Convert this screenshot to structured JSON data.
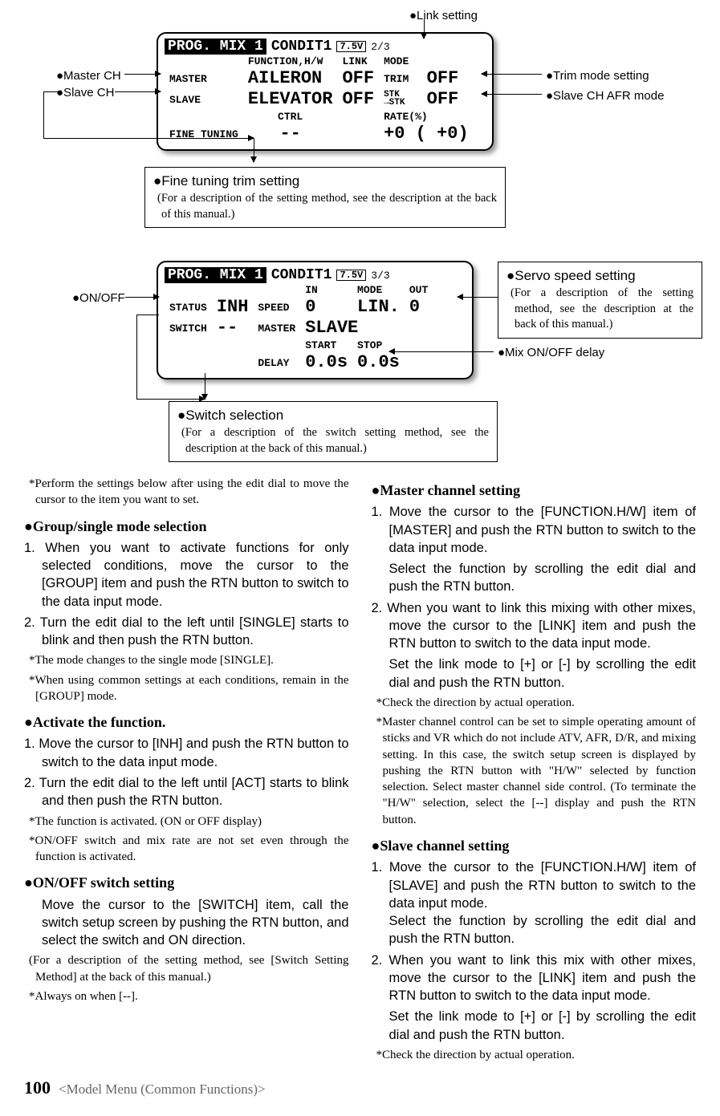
{
  "diagram": {
    "top_label_link": "●Link setting",
    "left_label_master": "●Master CH",
    "left_label_slave": "●Slave CH",
    "right_label_trim": "●Trim mode setting",
    "right_label_afr": "●Slave CH AFR mode",
    "left_label_onoff": "●ON/OFF",
    "right_label_mixdelay": "●Mix ON/OFF delay",
    "lcd1": {
      "title": "PROG. MIX 1",
      "condit": "CONDIT1",
      "batt": "7.5V",
      "page": "2/3",
      "func_hw": "FUNCTION,H/W",
      "link_hdr": "LINK",
      "mode_hdr": "MODE",
      "master_lbl": "MASTER",
      "master_val": "AILERON",
      "master_link": "OFF",
      "master_mode_lbl": "TRIM",
      "master_mode_val": "OFF",
      "slave_lbl": "SLAVE",
      "slave_val": "ELEVATOR",
      "slave_link": "OFF",
      "slave_mode_lbl": "STK\n→STK",
      "slave_mode_val": "OFF",
      "ctrl_hdr": "CTRL",
      "rate_hdr": "RATE(%)",
      "ft_lbl": "FINE TUNING",
      "ft_val": "--",
      "rate_val": "+0 (  +0)"
    },
    "callout_finetune": {
      "title": "●Fine tuning trim setting",
      "note": "(For a description of the setting method, see the description at the back of this manual.)"
    },
    "lcd2": {
      "title": "PROG. MIX 1",
      "condit": "CONDIT1",
      "batt": "7.5V",
      "page": "3/3",
      "in_hdr": "IN",
      "mode_hdr": "MODE",
      "out_hdr": "OUT",
      "status_lbl": "STATUS",
      "status_val": "INH",
      "speed_lbl": "SPEED",
      "speed_in": "0",
      "speed_mode": "LIN.",
      "speed_out": "0",
      "switch_lbl": "SWITCH",
      "switch_val": "--",
      "master_lbl": "MASTER",
      "master_val": "SLAVE",
      "start_hdr": "START",
      "stop_hdr": "STOP",
      "delay_lbl": "DELAY",
      "delay_start": "0.0s",
      "delay_stop": "0.0s"
    },
    "callout_servo": {
      "title": "●Servo speed setting",
      "note": "(For a description of the setting method, see the description at the back of this manual.)"
    },
    "callout_switch": {
      "title": "●Switch selection",
      "note": "(For a description of the switch setting method, see the description at the back of this manual.)"
    }
  },
  "intro_note": "*Perform the settings below after using the edit dial to move the cursor to the item you want to set.",
  "left": {
    "h1": "●Group/single mode selection",
    "s1": "1. When you want to activate functions for only selected conditions, move the cursor to the [GROUP] item and push the RTN button to switch to the data input mode.",
    "s2": "2. Turn the edit dial to the left until [SINGLE] starts to blink and then push the RTN button.",
    "n1": "*The mode changes to the single mode [SINGLE].",
    "n2": "*When using common settings at each conditions, remain in the [GROUP] mode.",
    "h2": "●Activate the function.",
    "s3": "1. Move the cursor to [INH] and push the RTN button to switch to the data input mode.",
    "s4": "2. Turn the edit dial to the left until [ACT] starts to blink and then push the RTN button.",
    "n3": "*The function is activated. (ON or OFF display)",
    "n4": "*ON/OFF switch and mix rate are not set even through the function is activated.",
    "h3": "●ON/OFF switch setting",
    "p1": "Move the cursor to the [SWITCH] item, call the switch setup screen by pushing the RTN button, and select the switch and ON direction.",
    "n5": "(For a description of the setting method, see [Switch Setting Method] at the back of this manual.)",
    "n6": "*Always on when [--]."
  },
  "right": {
    "h1": "●Master channel setting",
    "s1": "1. Move the cursor to the [FUNCTION.H/W] item of [MASTER] and push the RTN button to switch to the data input mode.",
    "p1": "Select the function by scrolling the edit dial and push the RTN button.",
    "s2": "2. When you want to link this mixing with other mixes, move the cursor to the [LINK] item and push the RTN button to switch to the data input mode.",
    "p2": "Set the link mode to [+] or [-] by scrolling the edit dial and push the RTN button.",
    "n1": "*Check the direction by actual operation.",
    "n2": "*Master channel control can be set to simple operating amount of sticks and VR which do not include ATV, AFR, D/R, and mixing setting. In this case, the switch setup screen is displayed by pushing the RTN button with \"H/W\" selected by function selection. Select master channel side control. (To terminate the \"H/W\" selection, select the [--] display and push the RTN button.",
    "h2": "●Slave channel setting",
    "s3": "1. Move the cursor to the [FUNCTION.H/W] item of [SLAVE] and push the RTN button to switch to the data input mode.\nSelect the function by scrolling the edit dial and push the RTN button.",
    "s4": "2. When you want to link this mix with other mixes, move the cursor to the [LINK] item and push the RTN button to switch to the data input mode.",
    "p3": "Set the link mode to [+] or [-] by scrolling the edit dial and push the RTN button.",
    "n3": "*Check the direction by actual operation."
  },
  "footer": {
    "page": "100",
    "title": "<Model Menu (Common Functions)>"
  }
}
